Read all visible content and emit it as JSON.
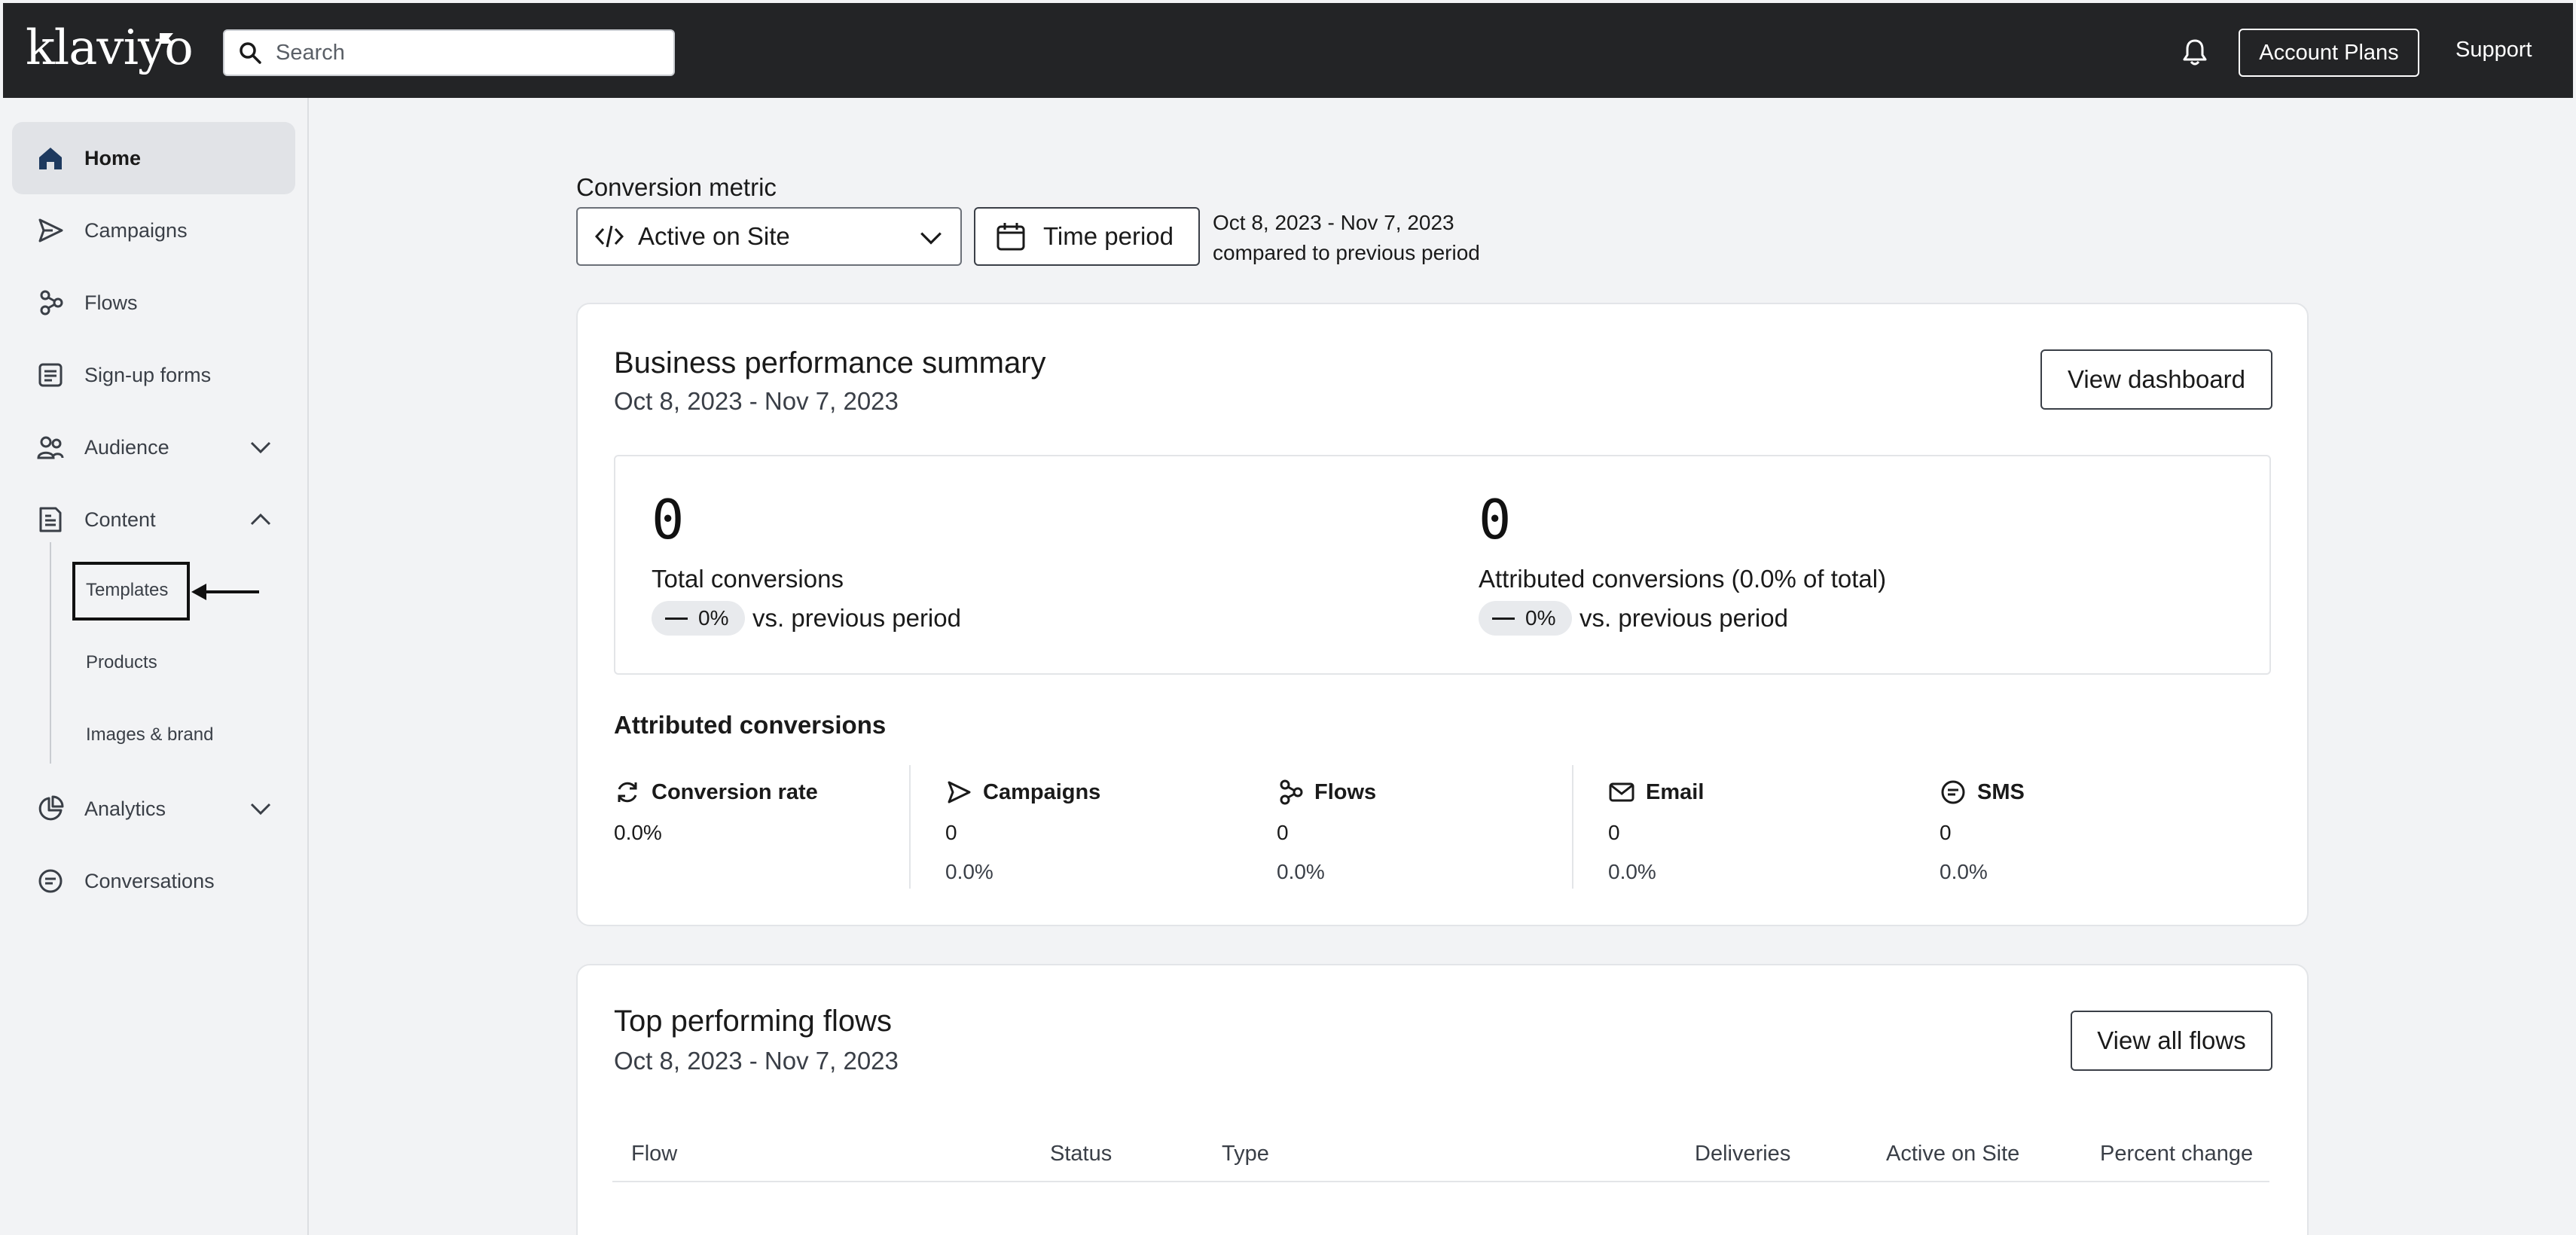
{
  "topbar": {
    "logo_text": "klaviyo",
    "search_placeholder": "Search",
    "account_plans_label": "Account Plans",
    "support_label": "Support"
  },
  "sidebar": {
    "items": [
      {
        "label": "Home",
        "icon": "home-icon"
      },
      {
        "label": "Campaigns",
        "icon": "send-icon"
      },
      {
        "label": "Flows",
        "icon": "flows-icon"
      },
      {
        "label": "Sign-up forms",
        "icon": "form-icon"
      },
      {
        "label": "Audience",
        "icon": "people-icon"
      },
      {
        "label": "Content",
        "icon": "content-icon"
      },
      {
        "label": "Analytics",
        "icon": "chart-icon"
      },
      {
        "label": "Conversations",
        "icon": "chat-icon"
      }
    ],
    "content_sub": [
      "Templates",
      "Products",
      "Images & brand"
    ]
  },
  "filters": {
    "conversion_metric_label": "Conversion metric",
    "metric_value": "Active on Site",
    "time_period_label": "Time period",
    "date_range": "Oct 8, 2023 - Nov 7, 2023",
    "comparison": "compared to previous period"
  },
  "summary": {
    "title": "Business performance summary",
    "date_range": "Oct 8, 2023 - Nov 7, 2023",
    "view_button": "View dashboard",
    "total": {
      "value": "0",
      "label": "Total conversions",
      "change": "0%",
      "vs": "vs. previous period"
    },
    "attributed": {
      "value": "0",
      "label": "Attributed conversions (0.0% of total)",
      "change": "0%",
      "vs": "vs. previous period"
    },
    "attributed_title": "Attributed conversions",
    "columns": [
      {
        "label": "Conversion rate",
        "icon": "refresh-icon",
        "value": "0.0%",
        "pct": ""
      },
      {
        "label": "Campaigns",
        "icon": "send-icon",
        "value": "0",
        "pct": "0.0%"
      },
      {
        "label": "Flows",
        "icon": "flows-icon",
        "value": "0",
        "pct": "0.0%"
      },
      {
        "label": "Email",
        "icon": "mail-icon",
        "value": "0",
        "pct": "0.0%"
      },
      {
        "label": "SMS",
        "icon": "sms-icon",
        "value": "0",
        "pct": "0.0%"
      }
    ]
  },
  "flows": {
    "title": "Top performing flows",
    "date_range": "Oct 8, 2023 - Nov 7, 2023",
    "view_button": "View all flows",
    "headers": [
      "Flow",
      "Status",
      "Type",
      "Deliveries",
      "Active on Site",
      "Percent change"
    ]
  },
  "colors": {
    "topbar_bg": "#232426",
    "sidebar_bg": "#f2f3f5",
    "active_item_bg": "#e1e3e7"
  }
}
